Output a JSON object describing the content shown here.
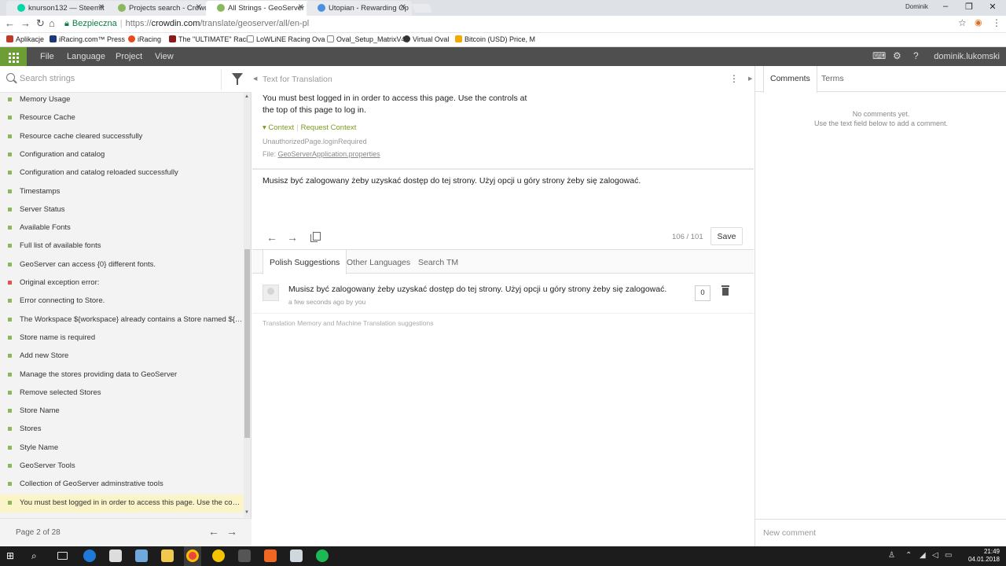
{
  "browser": {
    "tabs": [
      {
        "title": "knurson132 — Steemit",
        "color": "#06d6a9"
      },
      {
        "title": "Projects search - Crowdi",
        "color": "#8ab85a"
      },
      {
        "title": "All Strings - GeoServer -",
        "color": "#8ab85a"
      },
      {
        "title": "Utopian - Rewarding Op",
        "color": "#4a90e2"
      }
    ],
    "window_user": "Dominik",
    "address": {
      "secure_label": "Bezpieczna",
      "separator": "|",
      "protocol": "https://",
      "host": "crowdin.com",
      "path": "/translate/geoserver/all/en-pl"
    },
    "bookmarks": [
      {
        "label": "Aplikacje",
        "color": "#c0392b"
      },
      {
        "label": "iRacing.com™ Press",
        "color": "#1a3a7a"
      },
      {
        "label": "iRacing",
        "color": "#e84a1c"
      },
      {
        "label": "The \"ULTIMATE\" Raci",
        "color": "#8b1a1a"
      },
      {
        "label": "LoWLiNE Racing Ova",
        "color": "#888888"
      },
      {
        "label": "Oval_Setup_MatrixV4",
        "color": "#888888"
      },
      {
        "label": "Virtual Oval",
        "color": "#333333"
      },
      {
        "label": "Bitcoin (USD) Price, M",
        "color": "#f2a900"
      }
    ]
  },
  "app": {
    "menu": [
      "File",
      "Language",
      "Project",
      "View"
    ],
    "username": "dominik.lukomski",
    "accent": "#6d9e35"
  },
  "left": {
    "search_placeholder": "Search strings",
    "strings": [
      {
        "text": "Memory Usage",
        "status": "translated"
      },
      {
        "text": "Resource Cache",
        "status": "translated"
      },
      {
        "text": "Resource cache cleared successfully",
        "status": "translated"
      },
      {
        "text": "Configuration and catalog",
        "status": "translated"
      },
      {
        "text": "Configuration and catalog reloaded successfully",
        "status": "translated"
      },
      {
        "text": "Timestamps",
        "status": "translated"
      },
      {
        "text": "Server Status",
        "status": "translated"
      },
      {
        "text": "Available Fonts",
        "status": "translated"
      },
      {
        "text": "Full list of available fonts",
        "status": "translated"
      },
      {
        "text": "GeoServer can access {0} different fonts.",
        "status": "translated"
      },
      {
        "text": "Original exception error:",
        "status": "untranslated"
      },
      {
        "text": "Error connecting to Store.",
        "status": "translated"
      },
      {
        "text": "The Workspace ${workspace} already contains a Store named ${st...",
        "status": "translated"
      },
      {
        "text": "Store name is required",
        "status": "translated"
      },
      {
        "text": "Add new Store",
        "status": "translated"
      },
      {
        "text": "Manage the stores providing data to GeoServer",
        "status": "translated"
      },
      {
        "text": "Remove selected Stores",
        "status": "translated"
      },
      {
        "text": "Store Name",
        "status": "translated"
      },
      {
        "text": "Stores",
        "status": "translated"
      },
      {
        "text": "Style Name",
        "status": "translated"
      },
      {
        "text": "GeoServer Tools",
        "status": "translated"
      },
      {
        "text": "Collection of GeoServer adminstrative tools",
        "status": "translated"
      },
      {
        "text": "You must best logged in in order to access this page. Use the contr...",
        "status": "translated",
        "active": true
      }
    ],
    "pager": "Page 2 of 28"
  },
  "editor": {
    "source_heading": "Text for Translation",
    "source_text": "You must best logged in in order to access this page. Use the controls at the top of this page to log in.",
    "context_label": "Context",
    "request_context_label": "Request Context",
    "key": "UnauthorizedPage.loginRequired",
    "file_prefix": "File:",
    "file_name": "GeoServerApplication.properties",
    "translation": "Musisz być zalogowany żeby uzyskać dostęp do tej strony. Użyj opcji u góry strony żeby się zalogować.",
    "char_count": "106 / 101",
    "save_label": "Save",
    "tabs": [
      "Polish Suggestions",
      "Other Languages",
      "Search TM"
    ],
    "suggestion": {
      "text": "Musisz być zalogowany żeby uzyskać dostęp do tej strony. Użyj opcji u góry strony żeby się zalogować.",
      "meta": "a few seconds ago by you",
      "votes": "0"
    },
    "tm_label": "Translation Memory and Machine Translation suggestions"
  },
  "right": {
    "tabs": [
      "Comments",
      "Terms"
    ],
    "no_comments": "No comments yet.",
    "hint": "Use the text field below to add a comment.",
    "new_comment_placeholder": "New comment"
  },
  "taskbar": {
    "time": "21:49",
    "date": "04.01.2018"
  }
}
